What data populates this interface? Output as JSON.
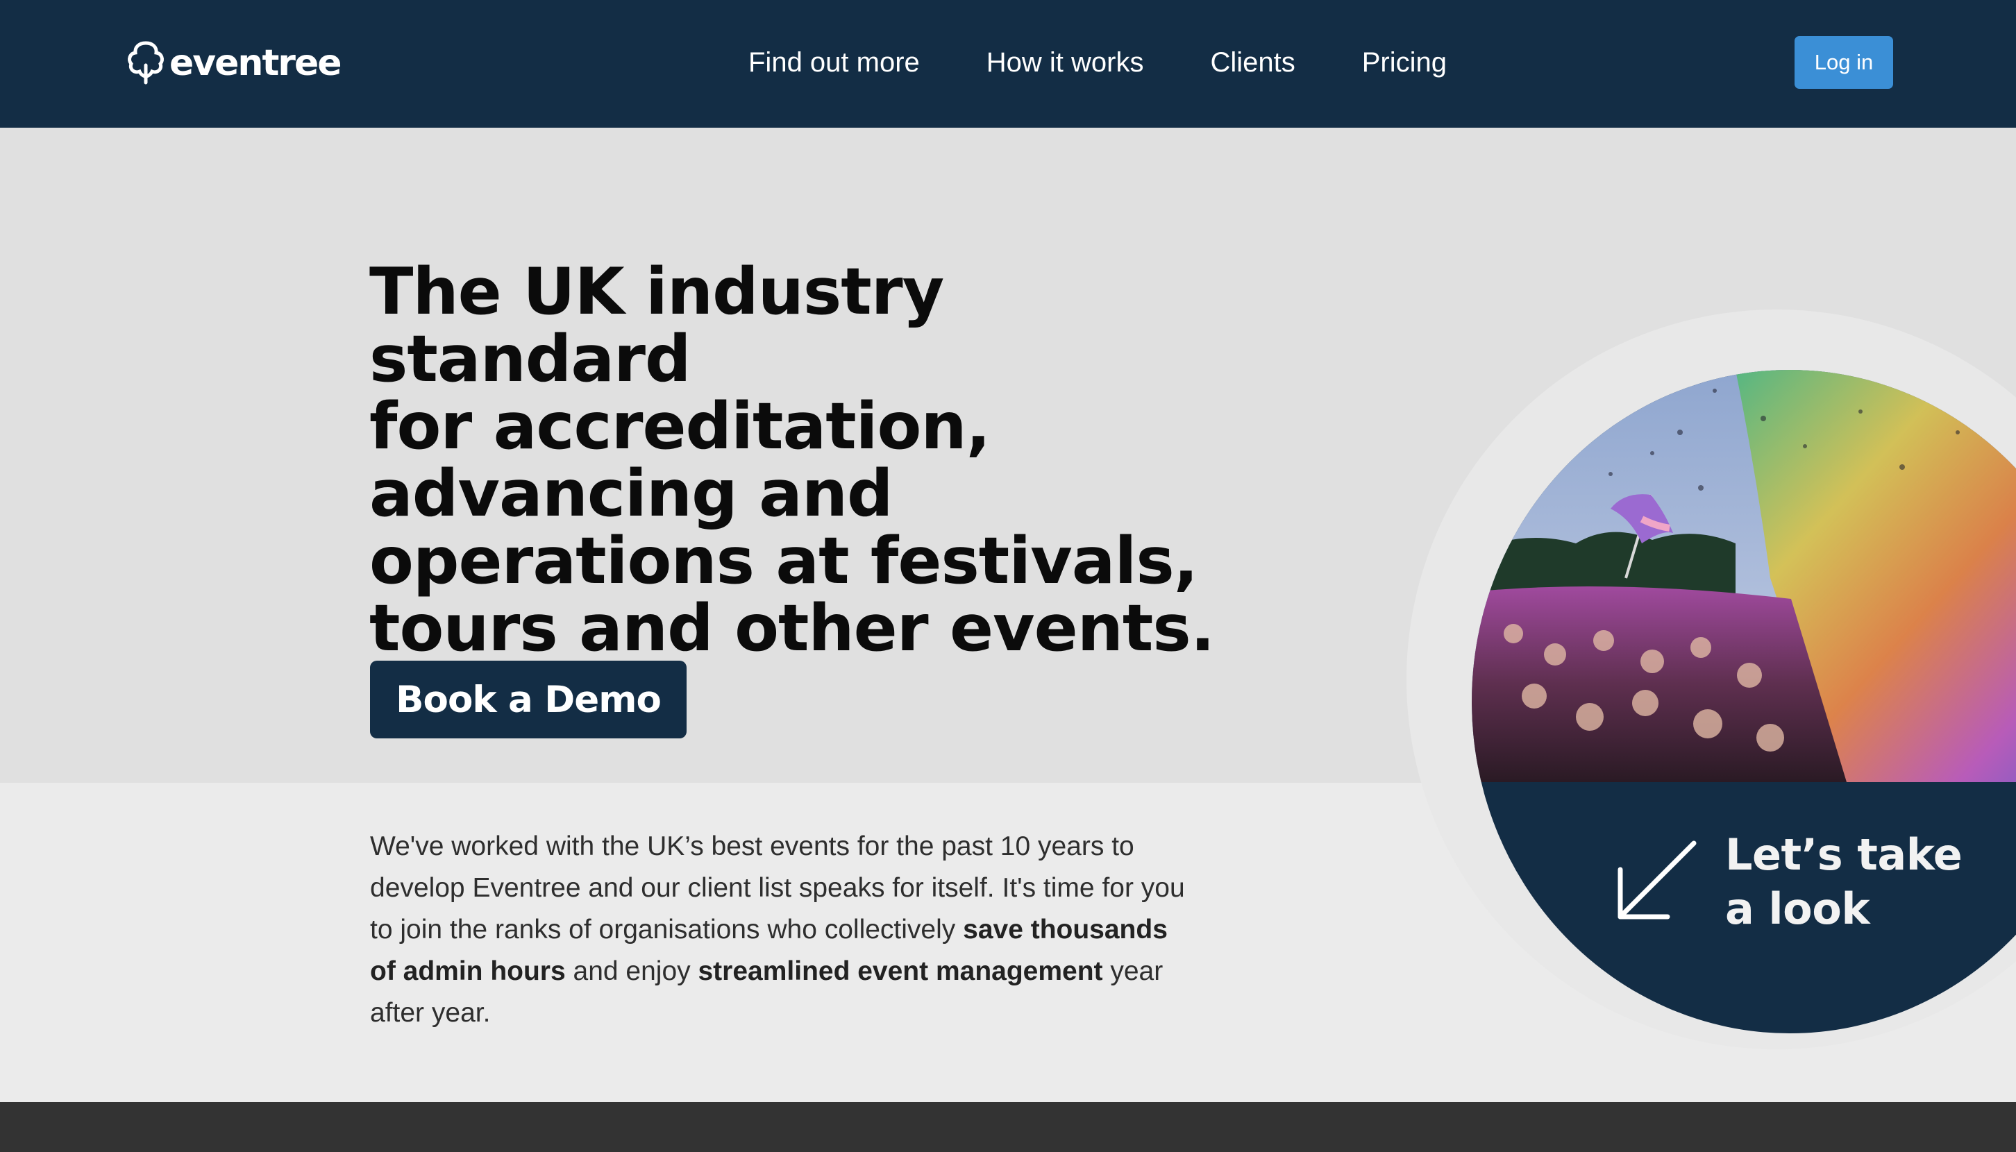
{
  "brand": {
    "name": "eventree",
    "icon": "tree-icon"
  },
  "nav": {
    "items": [
      "Find out more",
      "How it works",
      "Clients",
      "Pricing"
    ],
    "login_label": "Log in"
  },
  "hero": {
    "headline_lines": [
      "The UK industry standard",
      "for accreditation,",
      "advancing and",
      "operations at festivals,",
      "tours and other events."
    ],
    "cta_label": "Book a Demo"
  },
  "intro": {
    "part1": "We've worked with the UK’s best events for the past 10 years to develop Eventree and our client list speaks for itself. It's time for you to join the ranks of organisations who collectively ",
    "bold1": "save thousands of admin hours",
    "part2": " and enjoy ",
    "bold2": "streamlined event management",
    "part3": " year after year."
  },
  "feature": {
    "line1": "Let’s take",
    "line2": "a look",
    "arrow_icon": "arrow-down-left-icon"
  },
  "colors": {
    "navy": "#132d45",
    "login_blue": "#3b8fd6",
    "hero_bg": "#e0e0e0",
    "section_bg": "#ebebeb",
    "footer": "#333333"
  }
}
